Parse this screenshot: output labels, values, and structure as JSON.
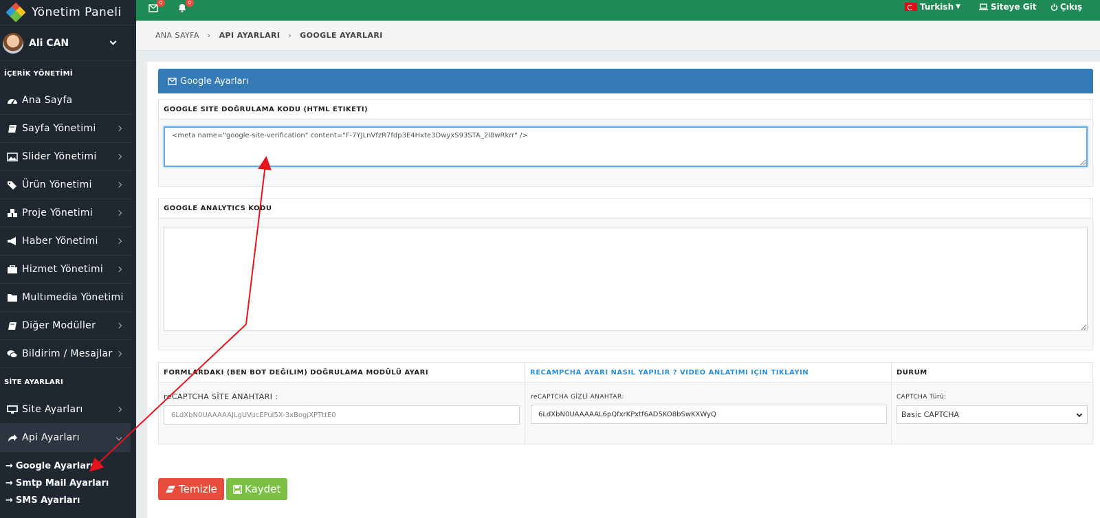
{
  "brand": {
    "title": "Yönetim Paneli"
  },
  "user": {
    "name": "Ali CAN"
  },
  "sidebar": {
    "section_content": "İÇERİK YÖNETİMİ",
    "items": [
      {
        "label": "Ana Sayfa",
        "icon": "dashboard-icon",
        "has_arrow": false
      },
      {
        "label": "Sayfa Yönetimi",
        "icon": "book-icon",
        "has_arrow": true
      },
      {
        "label": "Slider Yönetimi",
        "icon": "image-icon",
        "has_arrow": true
      },
      {
        "label": "Ürün Yönetimi",
        "icon": "tags-icon",
        "has_arrow": true
      },
      {
        "label": "Proje Yönetimi",
        "icon": "cubes-icon",
        "has_arrow": true
      },
      {
        "label": "Haber Yönetimi",
        "icon": "bullhorn-icon",
        "has_arrow": true
      },
      {
        "label": "Hizmet Yönetimi",
        "icon": "briefcase-icon",
        "has_arrow": true
      },
      {
        "label": "Multımedia Yönetimi",
        "icon": "folder-icon",
        "has_arrow": false
      },
      {
        "label": "Diğer Modüller",
        "icon": "book-icon",
        "has_arrow": true
      },
      {
        "label": "Bildirim / Mesajlar",
        "icon": "comments-icon",
        "has_arrow": true
      }
    ],
    "section_site": "SİTE AYARLARI",
    "site_items": [
      {
        "label": "Site Ayarları",
        "icon": "desktop-icon"
      },
      {
        "label": "Api Ayarları",
        "icon": "share-icon"
      }
    ],
    "sub_items": [
      {
        "label": "Google Ayarları"
      },
      {
        "label": "Smtp Mail Ayarları"
      },
      {
        "label": "SMS Ayarları"
      }
    ]
  },
  "topbar": {
    "mail_badge": "0",
    "bell_badge": "0",
    "language": "Turkish",
    "site_link": "Siteye Git",
    "logout": "Çıkış"
  },
  "breadcrumb": {
    "home": "ANA SAYFA",
    "level1": "API AYARLARI",
    "current": "GOOGLE AYARLARI"
  },
  "panel": {
    "title": "Google Ayarları"
  },
  "verification": {
    "title": "GOOGLE SITE DOĞRULAMA KODU (HTML ETIKETI)",
    "value": "<meta name=\"google-site-verification\" content=\"F-7YJLnVfzR7fdp3E4Hxte3DwyxS93STA_2l8wRkrr\" />"
  },
  "analytics": {
    "title": "GOOGLE ANALYTICS KODU",
    "value": ""
  },
  "captcha": {
    "col1_title": "FORMLARDAKI (BEN BOT DEĞILIM) DOĞRULAMA MODÜLÜ AYARI",
    "col2_title": "RECAMPCHA AYARI NASIL YAPILIR ? VIDEO ANLATIMI IÇIN TIKLAYIN",
    "col3_title": "DURUM",
    "site_key_label": "reCAPTCHA SİTE ANAHTARI :",
    "site_key_value": "6LdXbN0UAAAAAJLgUVucEPul5X-3xBogjXPTttE0",
    "secret_key_label": "reCAPTCHA GİZLİ ANAHTAR:",
    "secret_key_value": "6LdXbN0UAAAAAL6pQfxrKPxtf6AD5KO8bSwKXWyQ",
    "type_label": "CAPTCHA Türü:",
    "type_value": "Basic CAPTCHA"
  },
  "buttons": {
    "clear": "Temizle",
    "save": "Kaydet"
  },
  "colors": {
    "topbar": "#1e8a55",
    "panel_header": "#337ab7",
    "link": "#2a8fd8",
    "clear": "#e74c3c",
    "save": "#7bc043",
    "annotation": "#e8141b"
  }
}
